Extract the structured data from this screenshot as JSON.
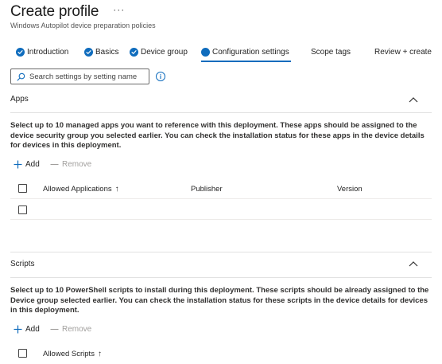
{
  "header": {
    "title": "Create profile",
    "more_icon": "ellipsis-icon",
    "subtitle": "Windows Autopilot device preparation policies"
  },
  "tabs": [
    {
      "label": "Introduction",
      "state": "complete"
    },
    {
      "label": "Basics",
      "state": "complete"
    },
    {
      "label": "Device group",
      "state": "complete"
    },
    {
      "label": "Configuration settings",
      "state": "active"
    },
    {
      "label": "Scope tags",
      "state": "pending"
    },
    {
      "label": "Review + create",
      "state": "pending"
    }
  ],
  "search": {
    "placeholder": "Search settings by setting name",
    "icon": "search-icon"
  },
  "apps": {
    "title": "Apps",
    "description": "Select up to 10 managed apps you want to reference with this deployment. These apps should be assigned to the device security group you selected earlier. You can check the installation status for these apps in the device details for devices in this deployment.",
    "add_label": "Add",
    "remove_label": "Remove",
    "columns": [
      "Allowed Applications",
      "Publisher",
      "Version"
    ],
    "sort_icon": "↑"
  },
  "scripts": {
    "title": "Scripts",
    "description": "Select up to 10 PowerShell scripts to install during this deployment. These scripts should be already assigned to the Device group selected earlier. You can check the installation status for these scripts in the device details for devices in this deployment.",
    "add_label": "Add",
    "remove_label": "Remove",
    "columns": [
      "Allowed Scripts"
    ],
    "sort_icon": "↑"
  },
  "colors": {
    "accent": "#0f6cbd",
    "disabled": "#a19f9d"
  }
}
